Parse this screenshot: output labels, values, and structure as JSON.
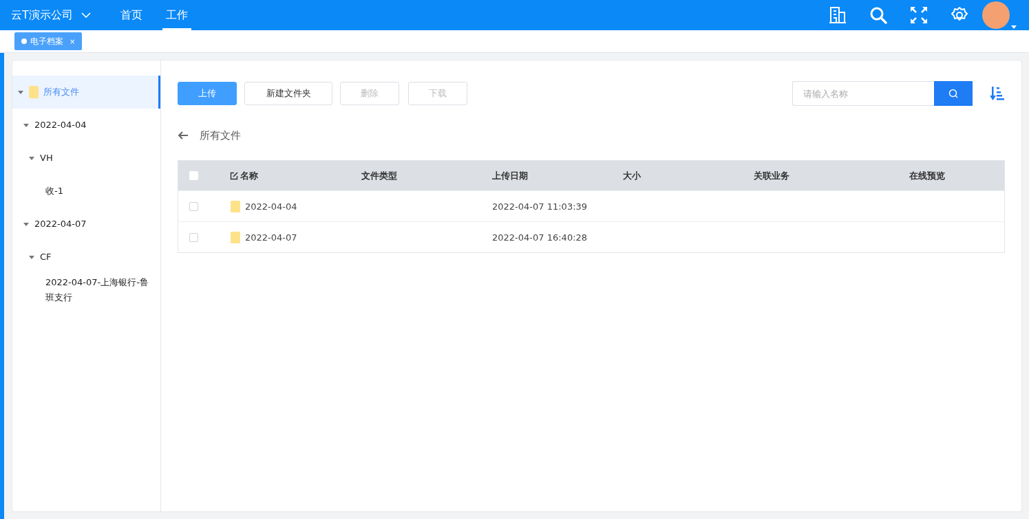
{
  "header": {
    "company": "云T演示公司",
    "nav": [
      {
        "label": "首页",
        "selected": false
      },
      {
        "label": "工作",
        "selected": true
      }
    ]
  },
  "tabs": [
    {
      "label": "电子档案",
      "close": "×",
      "selected": true
    }
  ],
  "tree": [
    {
      "label": "所有文件",
      "expanded": true,
      "selected": true,
      "children": [
        {
          "label": "2022-04-04",
          "expanded": true,
          "selected": false,
          "children": [
            {
              "label": "VH",
              "expanded": true,
              "selected": false,
              "children": [
                {
                  "label": "收-1",
                  "selected": false
                }
              ]
            }
          ]
        },
        {
          "label": "2022-04-07",
          "expanded": true,
          "selected": false,
          "children": [
            {
              "label": "CF",
              "expanded": true,
              "selected": false,
              "children": [
                {
                  "label": "2022-04-07-上海银行-鲁班支行",
                  "selected": false
                }
              ]
            }
          ]
        }
      ]
    }
  ],
  "toolbar": {
    "buttons": [
      {
        "label": "上传",
        "kind": "primary",
        "disabled": false
      },
      {
        "label": "新建文件夹",
        "kind": "default",
        "disabled": false
      },
      {
        "label": "删除",
        "kind": "default",
        "disabled": true
      },
      {
        "label": "下载",
        "kind": "default",
        "disabled": true
      }
    ],
    "search": {
      "placeholder": "请输入名称"
    }
  },
  "breadcrumb": "所有文件",
  "table": {
    "select_all_checked": false,
    "columns": [
      "名称",
      "文件类型",
      "上传日期",
      "大小",
      "关联业务",
      "在线预览"
    ],
    "rows": [
      {
        "checked": false,
        "name": "2022-04-04",
        "upload_date": "2022-04-07 11:03:39"
      },
      {
        "checked": false,
        "name": "2022-04-07",
        "upload_date": "2022-04-07 16:40:28"
      }
    ]
  }
}
